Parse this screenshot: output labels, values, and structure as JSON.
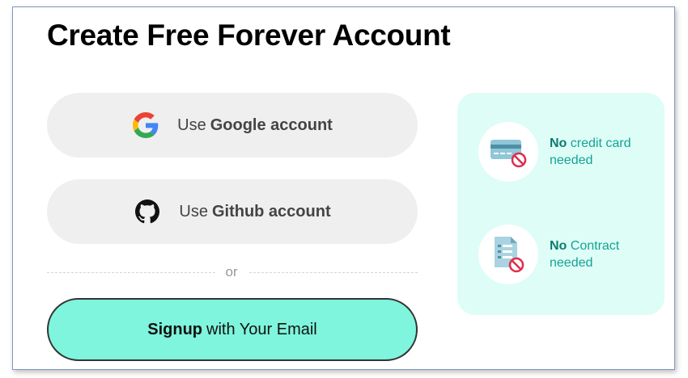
{
  "heading": "Create Free Forever Account",
  "google_button": {
    "prefix": "Use",
    "label": "Google account",
    "icon": "google-icon"
  },
  "github_button": {
    "prefix": "Use",
    "label": "Github account",
    "icon": "github-icon"
  },
  "divider_text": "or",
  "email_button": {
    "bold": "Signup",
    "label": "with Your Email"
  },
  "features": [
    {
      "bold": "No",
      "line1": "credit card",
      "line2": "needed",
      "icon": "credit-card-icon"
    },
    {
      "bold": "No",
      "line1": "Contract",
      "line2": "needed",
      "icon": "contract-icon"
    }
  ],
  "colors": {
    "accent": "#7ef5dc",
    "panel_bg": "#ddfdf6",
    "feature_text": "#14a394",
    "social_button_bg": "#efefef"
  }
}
